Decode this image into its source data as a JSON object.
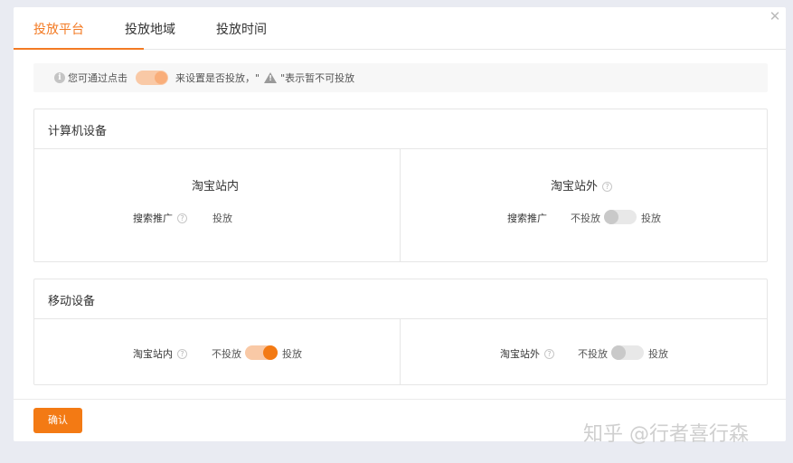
{
  "tabs": [
    {
      "label": "投放平台",
      "active": true
    },
    {
      "label": "投放地域",
      "active": false
    },
    {
      "label": "投放时间",
      "active": false
    }
  ],
  "close_icon": "close-icon",
  "tip": {
    "icon": "info-icon",
    "text_before": "您可通过点击",
    "text_middle": "来设置是否投放，\"",
    "warn_icon": "warning-icon",
    "text_after": "\"表示暂不可投放"
  },
  "desktop": {
    "title": "计算机设备",
    "left": {
      "title": "淘宝站内",
      "row_label": "搜索推广",
      "help_icon": "question-icon",
      "status": "投放"
    },
    "right": {
      "title": "淘宝站外",
      "help_icon": "question-icon",
      "row_label": "搜索推广",
      "off_label": "不投放",
      "on_label": "投放",
      "enabled": false
    }
  },
  "mobile": {
    "title": "移动设备",
    "left": {
      "row_label": "淘宝站内",
      "help_icon": "question-icon",
      "off_label": "不投放",
      "on_label": "投放",
      "enabled": true
    },
    "right": {
      "row_label": "淘宝站外",
      "help_icon": "question-icon",
      "off_label": "不投放",
      "on_label": "投放",
      "enabled": false
    }
  },
  "confirm_label": "确认",
  "watermark": "知乎 @行者喜行森",
  "colors": {
    "accent": "#f37a14",
    "accent_light": "#f9c9a6",
    "border": "#e6e6e6"
  }
}
